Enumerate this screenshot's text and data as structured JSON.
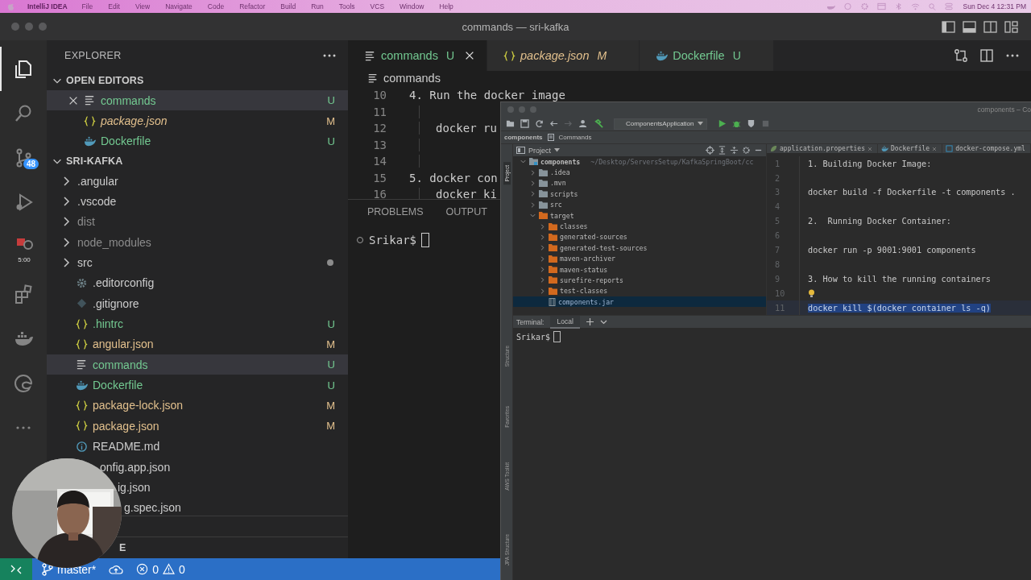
{
  "menu_bar": {
    "app": "IntelliJ IDEA",
    "items": [
      "File",
      "Edit",
      "View",
      "Navigate",
      "Code",
      "Refactor",
      "Build",
      "Run",
      "Tools",
      "VCS",
      "Window",
      "Help"
    ],
    "clock": "Sun Dec 4  12:31 PM"
  },
  "vscode": {
    "title": "commands — sri-kafka",
    "activity_bar": [
      {
        "kind": "files",
        "selected": true
      },
      {
        "kind": "search",
        "selected": false
      },
      {
        "kind": "source-control",
        "selected": false,
        "badge": "48"
      },
      {
        "kind": "run",
        "selected": false
      },
      {
        "kind": "timer",
        "selected": false,
        "caption": "5:00"
      },
      {
        "kind": "extensions",
        "selected": false
      },
      {
        "kind": "docker",
        "selected": false
      },
      {
        "kind": "browser",
        "selected": false
      },
      {
        "kind": "more",
        "selected": false
      }
    ],
    "sidebar": {
      "title": "EXPLORER",
      "sections": [
        {
          "title": "OPEN EDITORS",
          "expanded": true,
          "items": [
            {
              "name": "commands",
              "kind": "text",
              "color": "#73c991",
              "badge": "U",
              "selected": true,
              "closable": true,
              "preview": false
            },
            {
              "name": "package.json",
              "kind": "json",
              "color": "#e2c08d",
              "badge": "M",
              "selected": false,
              "closable": false,
              "preview": true
            },
            {
              "name": "Dockerfile",
              "kind": "docker",
              "color": "#73c991",
              "badge": "U",
              "selected": false,
              "closable": false,
              "preview": false
            }
          ]
        },
        {
          "title": "SRI-KAFKA",
          "expanded": true,
          "items": [
            {
              "name": ".angular",
              "kind": "folder",
              "expanded": false,
              "has_changes": false,
              "color": "#cccccc",
              "selected": false
            },
            {
              "name": ".vscode",
              "kind": "folder",
              "expanded": false,
              "has_changes": false,
              "color": "#cccccc",
              "selected": false
            },
            {
              "name": "dist",
              "kind": "folder",
              "expanded": false,
              "has_changes": false,
              "color": "#8c8c8c",
              "selected": false
            },
            {
              "name": "node_modules",
              "kind": "folder",
              "expanded": false,
              "has_changes": false,
              "color": "#8c8c8c",
              "selected": false
            },
            {
              "name": "src",
              "kind": "folder",
              "expanded": false,
              "has_changes": true,
              "color": "#cccccc",
              "selected": false
            },
            {
              "name": ".editorconfig",
              "kind": "settings",
              "color": "#cccccc",
              "selected": false
            },
            {
              "name": ".gitignore",
              "kind": "git",
              "color": "#cccccc",
              "selected": false
            },
            {
              "name": ".hintrc",
              "kind": "json",
              "color": "#73c991",
              "badge": "U",
              "selected": false
            },
            {
              "name": "angular.json",
              "kind": "json",
              "color": "#e2c08d",
              "badge": "M",
              "selected": false
            },
            {
              "name": "commands",
              "kind": "text",
              "color": "#73c991",
              "badge": "U",
              "selected": true
            },
            {
              "name": "Dockerfile",
              "kind": "docker",
              "color": "#73c991",
              "badge": "U",
              "selected": false
            },
            {
              "name": "package-lock.json",
              "kind": "json",
              "color": "#e2c08d",
              "badge": "M",
              "selected": false
            },
            {
              "name": "package.json",
              "kind": "json",
              "color": "#e2c08d",
              "badge": "M",
              "selected": false
            },
            {
              "name": "README.md",
              "kind": "info",
              "color": "#cccccc",
              "selected": false
            },
            {
              "name": "onfig.app.json",
              "kind": "covered",
              "color": "#cccccc",
              "selected": false
            },
            {
              "name": "ig.json",
              "kind": "covered",
              "color": "#cccccc",
              "selected": false
            },
            {
              "name": "g.spec.json",
              "kind": "covered",
              "color": "#cccccc",
              "selected": false
            }
          ]
        },
        {
          "title": "E",
          "expanded": false
        }
      ]
    },
    "tabs": [
      {
        "label": "commands",
        "kind": "text",
        "color": "#73c991",
        "badge": "U",
        "selected": true,
        "preview": false
      },
      {
        "label": "package.json",
        "kind": "json",
        "color": "#e2c08d",
        "badge": "M",
        "selected": false,
        "preview": true
      },
      {
        "label": "Dockerfile",
        "kind": "docker",
        "color": "#73c991",
        "badge": "U",
        "selected": false,
        "preview": false
      }
    ],
    "breadcrumb": "commands",
    "code": [
      {
        "number": "10",
        "text": "4. Run the docker image",
        "indent": false
      },
      {
        "number": "11",
        "indent": true
      },
      {
        "number": "12",
        "text": "docker ru",
        "indent": true
      },
      {
        "number": "13",
        "indent": true
      },
      {
        "number": "14",
        "indent": true
      },
      {
        "number": "15",
        "text": "5. docker con",
        "indent": false
      },
      {
        "number": "16",
        "text": "docker ki",
        "indent": true
      }
    ],
    "panel_tabs": [
      {
        "label": "PROBLEMS",
        "selected": false
      },
      {
        "label": "OUTPUT",
        "selected": false
      }
    ],
    "terminal_prompt": "Srikar$",
    "status_bar": {
      "branch": "master*",
      "errors": "0",
      "warnings": "0"
    }
  },
  "intellij": {
    "title": "components – Co",
    "run_config": "ComponentsApplication",
    "breadcrumbs": [
      "components",
      "Commands"
    ],
    "tool_strip": [
      {
        "label": "Project",
        "selected": true
      },
      {
        "label": "Structure",
        "selected": false
      },
      {
        "label": "Favorites",
        "selected": false
      },
      {
        "label": "AWS Toolkit",
        "selected": false
      },
      {
        "label": "JPA Structure",
        "selected": false
      }
    ],
    "project_title": "Project",
    "tree": [
      {
        "name": "components",
        "path": "~/Desktop/ServersSetup/KafkaSpringBoot/cc",
        "kind": "module",
        "expanded": true,
        "selected": false,
        "children": [
          {
            "name": ".idea",
            "kind": "folder",
            "expanded": false,
            "selected": false
          },
          {
            "name": ".mvn",
            "kind": "folder",
            "expanded": false,
            "selected": false
          },
          {
            "name": "scripts",
            "kind": "folder",
            "expanded": false,
            "selected": false
          },
          {
            "name": "src",
            "kind": "folder",
            "expanded": false,
            "selected": false
          },
          {
            "name": "target",
            "kind": "excluded",
            "expanded": true,
            "selected": false,
            "children": [
              {
                "name": "classes",
                "kind": "excluded",
                "expanded": false,
                "selected": false
              },
              {
                "name": "generated-sources",
                "kind": "excluded",
                "expanded": false,
                "selected": false
              },
              {
                "name": "generated-test-sources",
                "kind": "excluded",
                "expanded": false,
                "selected": false
              },
              {
                "name": "maven-archiver",
                "kind": "excluded",
                "expanded": false,
                "selected": false
              },
              {
                "name": "maven-status",
                "kind": "excluded",
                "expanded": false,
                "selected": false
              },
              {
                "name": "surefire-reports",
                "kind": "excluded",
                "expanded": false,
                "selected": false
              },
              {
                "name": "test-classes",
                "kind": "excluded",
                "expanded": false,
                "selected": false
              },
              {
                "name": "components.jar",
                "kind": "jar",
                "selected": true
              }
            ]
          }
        ]
      }
    ],
    "editor_tabs": [
      {
        "label": "application.properties",
        "kind": "leaf",
        "closable": true
      },
      {
        "label": "Dockerfile",
        "kind": "docker",
        "closable": true
      },
      {
        "label": "docker-compose.yml",
        "kind": "compose",
        "closable": false
      }
    ],
    "lines": [
      {
        "number": "1",
        "text": "1. Building Docker Image:",
        "selected": false,
        "hint": false
      },
      {
        "number": "2",
        "selected": false,
        "hint": false
      },
      {
        "number": "3",
        "text": "docker build -f Dockerfile -t components .",
        "selected": false,
        "hint": false
      },
      {
        "number": "4",
        "selected": false,
        "hint": false
      },
      {
        "number": "5",
        "text": "2.  Running Docker Container:",
        "selected": false,
        "hint": false
      },
      {
        "number": "6",
        "selected": false,
        "hint": false
      },
      {
        "number": "7",
        "text": "docker run -p 9001:9001 components",
        "selected": false,
        "hint": false
      },
      {
        "number": "8",
        "selected": false,
        "hint": false
      },
      {
        "number": "9",
        "text": "3. How to kill the running containers",
        "selected": false,
        "hint": false
      },
      {
        "number": "10",
        "selected": false,
        "hint": true
      },
      {
        "number": "11",
        "text": "docker kill $(docker container ls -q)",
        "selected": true,
        "hint": false
      }
    ],
    "terminal": {
      "title": "Terminal:",
      "tabs": [
        {
          "label": "Local",
          "selected": true
        }
      ],
      "prompt": "Srikar$"
    }
  }
}
